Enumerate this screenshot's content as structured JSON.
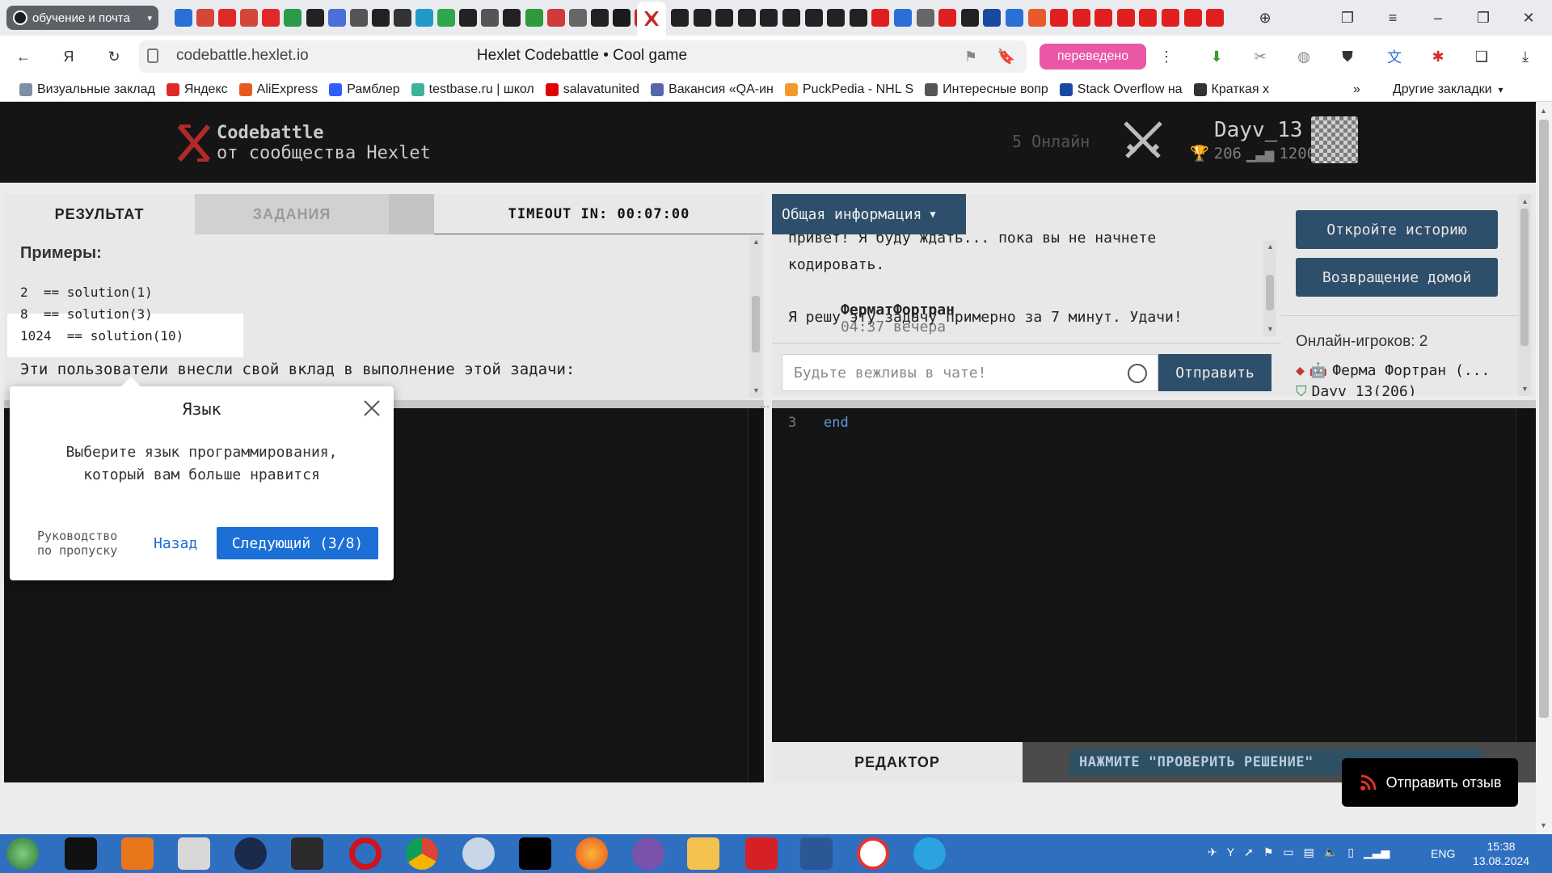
{
  "browser": {
    "tab_group_label": "обучение и почта",
    "url": "codebattle.hexlet.io",
    "page_title": "Hexlet Codebattle • Cool game",
    "translated_label": "переведено",
    "bookmarks": [
      {
        "label": "Визуальные заклад",
        "color": "#7b8fa6"
      },
      {
        "label": "Яндекс",
        "color": "#e02a2a"
      },
      {
        "label": "AliExpress",
        "color": "#e65a1f"
      },
      {
        "label": "Рамблер",
        "color": "#315efb"
      },
      {
        "label": "testbase.ru | школ",
        "color": "#3cb39a"
      },
      {
        "label": "salavatunited",
        "color": "#e00000"
      },
      {
        "label": "Вакансия «QA-ин",
        "color": "#5566aa"
      },
      {
        "label": "PuckPedia - NHL S",
        "color": "#f29a2e"
      },
      {
        "label": "Интересные вопр",
        "color": "#555555"
      },
      {
        "label": "Stack Overflow на",
        "color": "#1a4aa0"
      },
      {
        "label": "Краткая х",
        "color": "#333333"
      }
    ],
    "other_bookmarks_label": "Другие закладки"
  },
  "header": {
    "logo_title": "Codebattle",
    "logo_subtitle": "от сообщества Hexlet",
    "online": "5 Онлайн",
    "username": "Dayv_13",
    "rank": "206",
    "rating": "1200"
  },
  "left_tabs": {
    "result": "РЕЗУЛЬТАТ",
    "tasks": "ЗАДАНИЯ",
    "timeout": "TIMEOUT IN: 00:07:00"
  },
  "result": {
    "examples_heading": "Примеры:",
    "examples": [
      "2  == solution(1)",
      "8  == solution(3)",
      "1024  == solution(10)"
    ],
    "contributors_text": "Эти пользователи внесли свой вклад в выполнение этой задачи:"
  },
  "popup": {
    "title": "Язык",
    "text": "Выберите язык программирования, который вам больше нравится",
    "skip_line1": "Руководство",
    "skip_line2": "по пропуску",
    "back": "Назад",
    "next": "Следующий (3/8)"
  },
  "chat": {
    "dropdown_label": "Общая информация",
    "partial_line1": "привет! Я буду ждать... пока вы не начнете",
    "partial_line2": "кодировать.",
    "author": "ФерматФортран",
    "time": "04:37 вечера",
    "message": "Я решу эту задачу примерно за 7 минут. Удачи!",
    "input_placeholder": "Будьте вежливы в чате!",
    "send": "Отправить"
  },
  "side": {
    "open_history": "Откройте историю",
    "go_home": "Возвращение домой",
    "online_players": "Онлайн-игроков: 2",
    "players": [
      "Ферма Фортран (...",
      "Dayv_13(206)"
    ]
  },
  "editor": {
    "line_number": "3",
    "code": "end",
    "tab_label": "РЕДАКТОР",
    "check_hint": "НАЖМИТЕ \"ПРОВЕРИТЬ РЕШЕНИЕ\""
  },
  "feedback": "Отправить отзыв",
  "taskbar": {
    "lang": "ENG",
    "time": "15:38",
    "date": "13.08.2024"
  },
  "colors": {
    "accent_blue": "#2e4f6b",
    "popup_primary": "#1b6fd6",
    "header_bg": "#151515",
    "translated_pink": "#e957a6"
  }
}
